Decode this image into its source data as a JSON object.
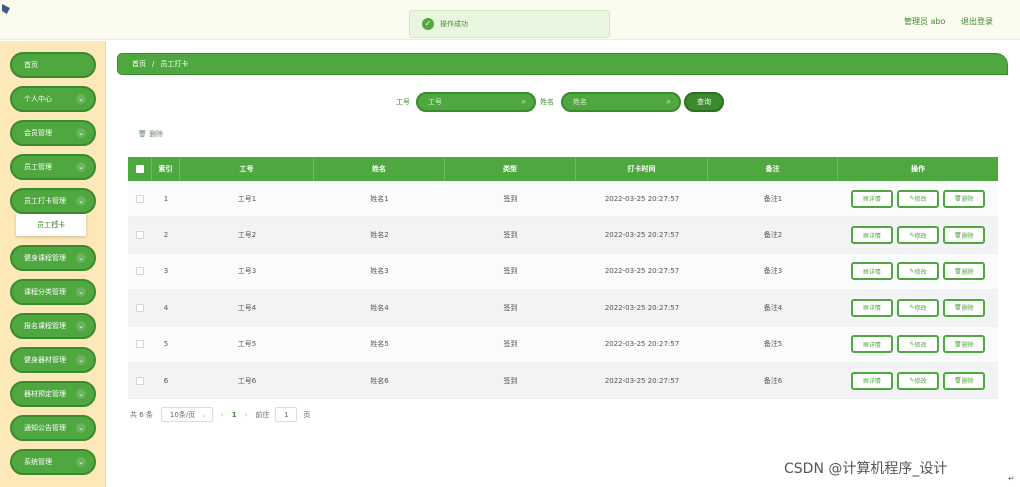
{
  "header": {
    "toast_text": "操作成功",
    "toast_icon": "check-icon",
    "admin_label": "管理员 abo",
    "logout_label": "退出登录"
  },
  "sidebar": {
    "items": [
      {
        "label": "首页",
        "has_chevron": false
      },
      {
        "label": "个人中心",
        "has_chevron": true
      },
      {
        "label": "会员管理",
        "has_chevron": true
      },
      {
        "label": "员工管理",
        "has_chevron": true
      },
      {
        "label": "员工打卡管理",
        "has_chevron": true
      },
      {
        "label": "健身课程管理",
        "has_chevron": true
      },
      {
        "label": "课程分类管理",
        "has_chevron": true
      },
      {
        "label": "报名课程管理",
        "has_chevron": true
      },
      {
        "label": "健身器材管理",
        "has_chevron": true
      },
      {
        "label": "器材预定管理",
        "has_chevron": true
      },
      {
        "label": "通知公告管理",
        "has_chevron": true
      },
      {
        "label": "系统管理",
        "has_chevron": true
      }
    ],
    "submenu_label": "员工打卡"
  },
  "breadcrumb": {
    "home": "首页",
    "sep": "/",
    "current": "员工打卡"
  },
  "search": {
    "label1": "工号",
    "placeholder1": "工号",
    "label2": "姓名",
    "placeholder2": "姓名",
    "button": "查询"
  },
  "toolbar": {
    "delete_label": "删除"
  },
  "table": {
    "headers": [
      "索引",
      "工号",
      "姓名",
      "类型",
      "打卡时间",
      "备注",
      "操作"
    ],
    "rows": [
      {
        "index": "1",
        "id": "工号1",
        "name": "姓名1",
        "type": "签到",
        "time": "2022-03-25 20:27:57",
        "note": "备注1"
      },
      {
        "index": "2",
        "id": "工号2",
        "name": "姓名2",
        "type": "签到",
        "time": "2022-03-25 20:27:57",
        "note": "备注2"
      },
      {
        "index": "3",
        "id": "工号3",
        "name": "姓名3",
        "type": "签到",
        "time": "2022-03-25 20:27:57",
        "note": "备注3"
      },
      {
        "index": "4",
        "id": "工号4",
        "name": "姓名4",
        "type": "签到",
        "time": "2022-03-25 20:27:57",
        "note": "备注4"
      },
      {
        "index": "5",
        "id": "工号5",
        "name": "姓名5",
        "type": "签到",
        "time": "2022-03-25 20:27:57",
        "note": "备注5"
      },
      {
        "index": "6",
        "id": "工号6",
        "name": "姓名6",
        "type": "签到",
        "time": "2022-03-25 20:27:57",
        "note": "备注6"
      }
    ],
    "actions": {
      "detail": "详情",
      "edit": "修改",
      "delete": "删除"
    }
  },
  "pager": {
    "total": "共 6 条",
    "page_size": "10条/页",
    "current_page": "1",
    "goto_prefix": "前往",
    "goto_value": "1",
    "goto_suffix": "页"
  },
  "watermark": "CSDN @计算机程序_设计",
  "colors": {
    "primary": "#4fa740",
    "primary_dark": "#3c8a2e",
    "sidebar_bg": "#fce8b8",
    "topbar_bg": "#fbfcef"
  }
}
